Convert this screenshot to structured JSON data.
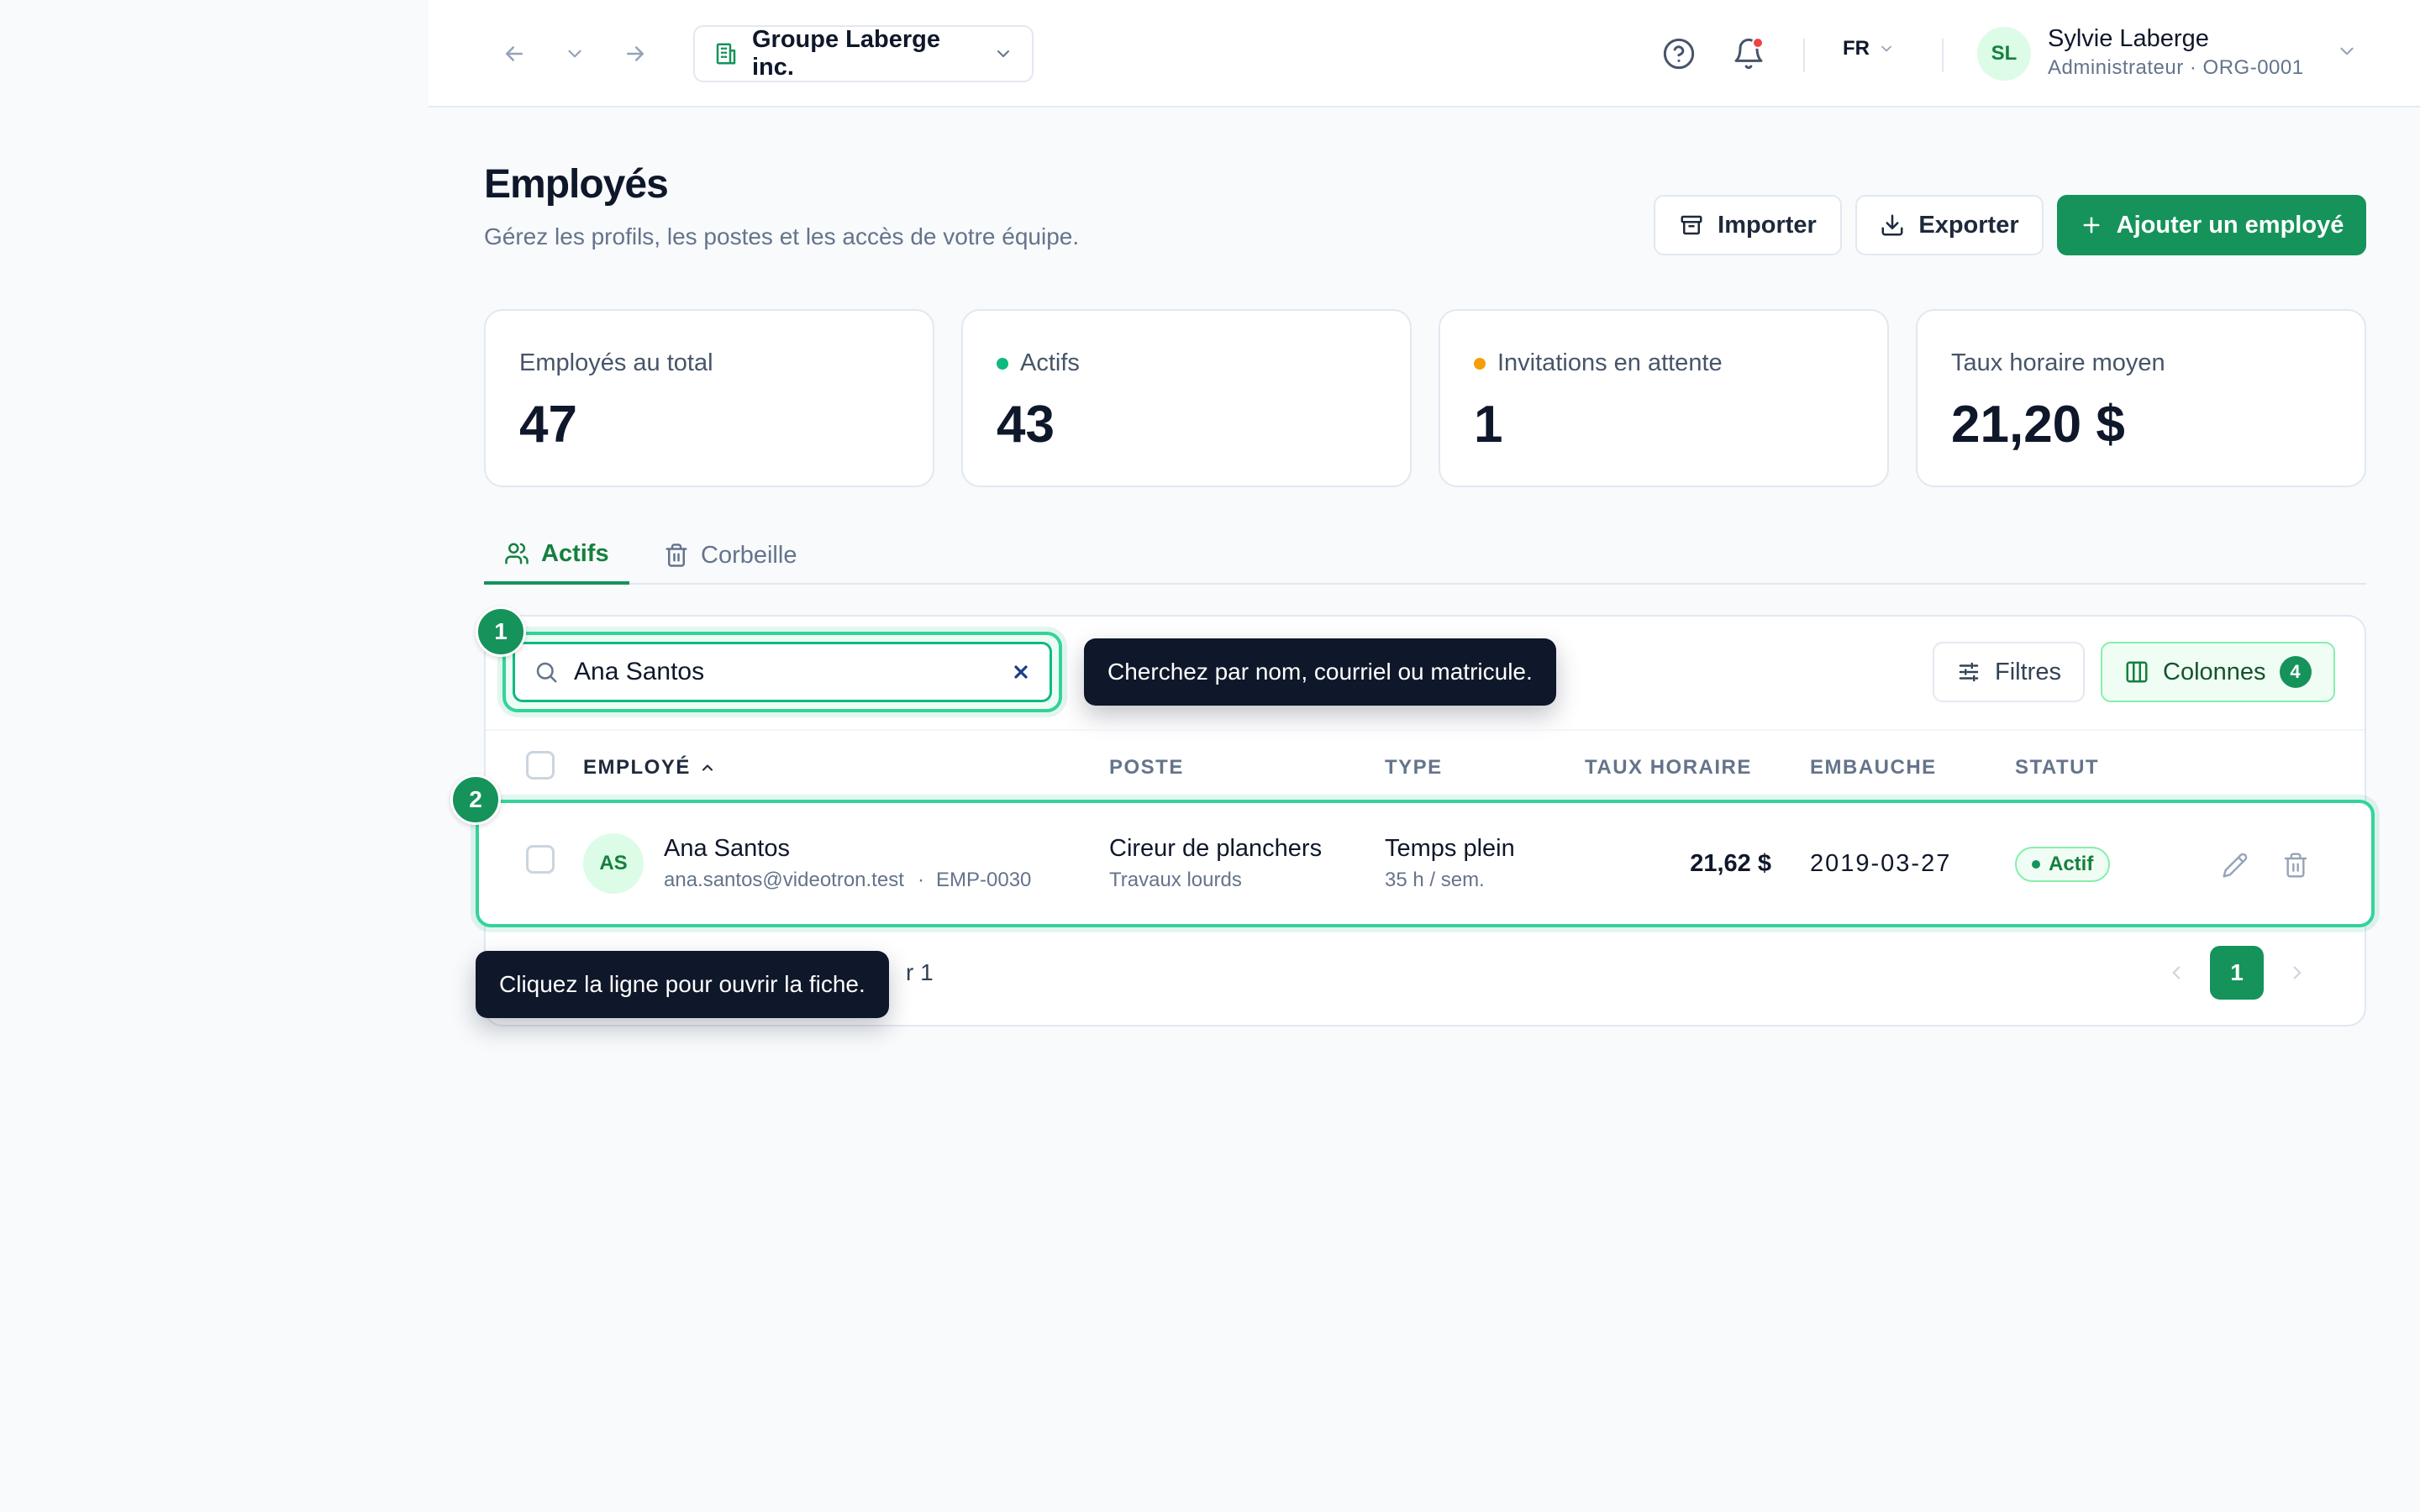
{
  "topbar": {
    "org_name": "Groupe Laberge inc.",
    "language": "FR",
    "user": {
      "initials": "SL",
      "name": "Sylvie Laberge",
      "role": "Administrateur · ORG-0001"
    },
    "notification_color": "#ef4444"
  },
  "header": {
    "title": "Employés",
    "subtitle": "Gérez les profils, les postes et les accès de votre équipe.",
    "import_label": "Importer",
    "export_label": "Exporter",
    "add_label": "Ajouter un employé"
  },
  "stats": [
    {
      "label": "Employés au total",
      "value": "47"
    },
    {
      "label": "Actifs",
      "value": "43",
      "dot_color": "#10b981"
    },
    {
      "label": "Invitations en attente",
      "value": "1",
      "dot_color": "#f59e0b"
    },
    {
      "label": "Taux horaire moyen",
      "value": "21,20 $"
    }
  ],
  "tabs": [
    {
      "label": "Actifs",
      "active": true
    },
    {
      "label": "Corbeille",
      "active": false
    }
  ],
  "toolbar": {
    "search_value": "Ana Santos",
    "filters_label": "Filtres",
    "columns_label": "Colonnes",
    "columns_count": "4"
  },
  "tour": {
    "step1": "1",
    "step1_tip": "Cherchez par nom, courriel ou matricule.",
    "step2": "2",
    "step2_tip": "Cliquez la ligne pour ouvrir la fiche."
  },
  "table": {
    "columns": [
      "EMPLOYÉ",
      "POSTE",
      "TYPE",
      "TAUX HORAIRE",
      "EMBAUCHE",
      "STATUT"
    ],
    "rows": [
      {
        "initials": "AS",
        "name": "Ana Santos",
        "email": "ana.santos@videotron.test",
        "matricule": "EMP-0030",
        "poste": "Cireur de planchers",
        "departement": "Travaux lourds",
        "type": "Temps plein",
        "heures": "35 h / sem.",
        "taux": "21,62 $",
        "embauche": "2019-03-27",
        "statut": "Actif"
      }
    ]
  },
  "pagination": {
    "partial_text": "r 1",
    "current_page": "1"
  },
  "colors": {
    "primary": "#15935a",
    "accent_ring": "#34d399",
    "tooltip_bg": "#0f172a"
  }
}
